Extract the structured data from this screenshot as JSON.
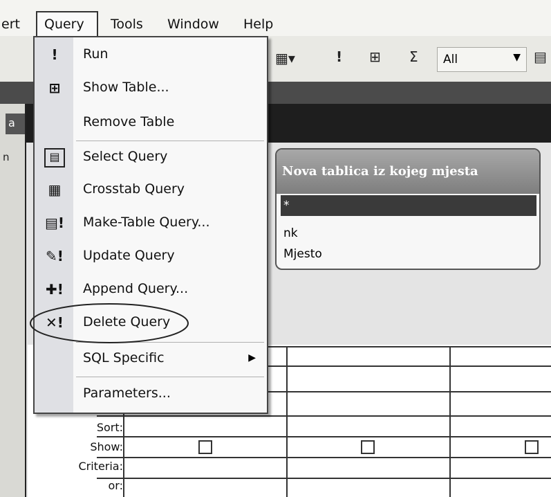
{
  "menubar": {
    "partial": "ert",
    "items": [
      "Query",
      "Tools",
      "Window",
      "Help"
    ]
  },
  "toolbar": {
    "run_glyph": "!",
    "sigma_glyph": "Σ",
    "combo_value": "All"
  },
  "side_partial": [
    "a",
    "n"
  ],
  "menu": {
    "items": [
      {
        "label": "Run",
        "icon": "run-icon"
      },
      {
        "label": "Show Table...",
        "icon": "show-table-icon"
      },
      {
        "label": "Remove Table",
        "icon": ""
      },
      {
        "label": "Select Query",
        "icon": "select-query-icon"
      },
      {
        "label": "Crosstab Query",
        "icon": "crosstab-query-icon"
      },
      {
        "label": "Make-Table Query...",
        "icon": "make-table-query-icon"
      },
      {
        "label": "Update Query",
        "icon": "update-query-icon"
      },
      {
        "label": "Append Query...",
        "icon": "append-query-icon"
      },
      {
        "label": "Delete Query",
        "icon": "delete-query-icon"
      },
      {
        "label": "SQL Specific",
        "icon": ""
      },
      {
        "label": "Parameters...",
        "icon": ""
      }
    ]
  },
  "table_box": {
    "title": "Nova tablica iz kojeg mjesta",
    "fields": [
      "*",
      "nk",
      "Mjesto"
    ]
  },
  "grid": {
    "row_labels": [
      "Sort:",
      "Show:",
      "Criteria:",
      "or:"
    ]
  },
  "colors": {
    "highlight": "#3a3a3a",
    "menu_bg": "#f8f8f8"
  }
}
